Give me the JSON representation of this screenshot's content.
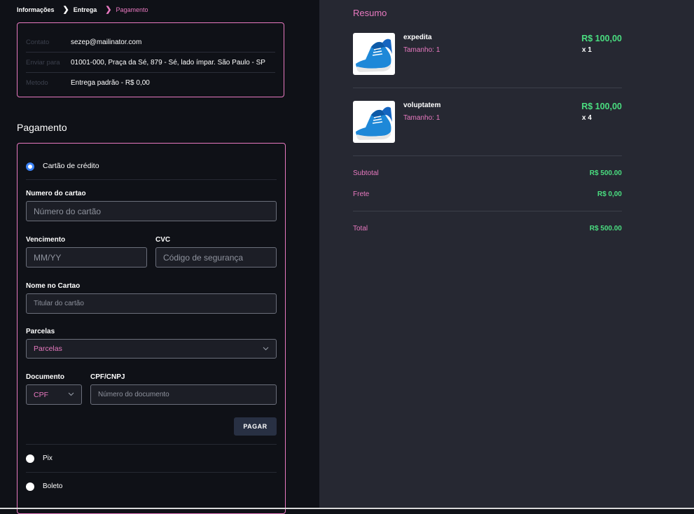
{
  "breadcrumb": {
    "step1": "Informações",
    "step2": "Entrega",
    "step3": "Pagamento"
  },
  "info": {
    "rows": [
      {
        "key": "Contato",
        "value": "sezep@mailinator.com"
      },
      {
        "key": "Enviar para",
        "value": "01001-000, Praça da Sé, 879 - Sé, lado ímpar. São Paulo - SP"
      },
      {
        "key": "Metodo",
        "value": "Entrega padrão - R$ 0,00"
      }
    ]
  },
  "payment": {
    "title": "Pagamento",
    "credit_label": "Cartão de crédito",
    "card_number_label": "Numero do cartao",
    "card_number_placeholder": "Número do cartão",
    "expiry_label": "Vencimento",
    "expiry_placeholder": "MM/YY",
    "cvc_label": "CVC",
    "cvc_placeholder": "Código de segurança",
    "holder_label": "Nome no Cartao",
    "holder_placeholder": "Titular do cartão",
    "installments_label": "Parcelas",
    "installments_value": "Parcelas",
    "document_label": "Documento",
    "document_value": "CPF",
    "doc_number_label": "CPF/CNPJ",
    "doc_number_placeholder": "Número do documento",
    "pay_button": "PAGAR",
    "pix_label": "Pix",
    "boleto_label": "Boleto"
  },
  "summary": {
    "title": "Resumo",
    "items": [
      {
        "name": "expedita",
        "size": "Tamanho: 1",
        "price": "R$ 100,00",
        "qty": "x 1"
      },
      {
        "name": "voluptatem",
        "size": "Tamanho: 1",
        "price": "R$ 100,00",
        "qty": "x 4"
      }
    ],
    "subtotal_label": "Subtotal",
    "subtotal_value": "R$ 500.00",
    "shipping_label": "Frete",
    "shipping_value": "R$ 0,00",
    "total_label": "Total",
    "total_value": "R$ 500.00"
  },
  "colors": {
    "accent": "#e879c0",
    "price": "#4ade80",
    "radio_selected": "#3b82f6",
    "left_bg": "#0f1117",
    "right_bg": "#262832"
  }
}
